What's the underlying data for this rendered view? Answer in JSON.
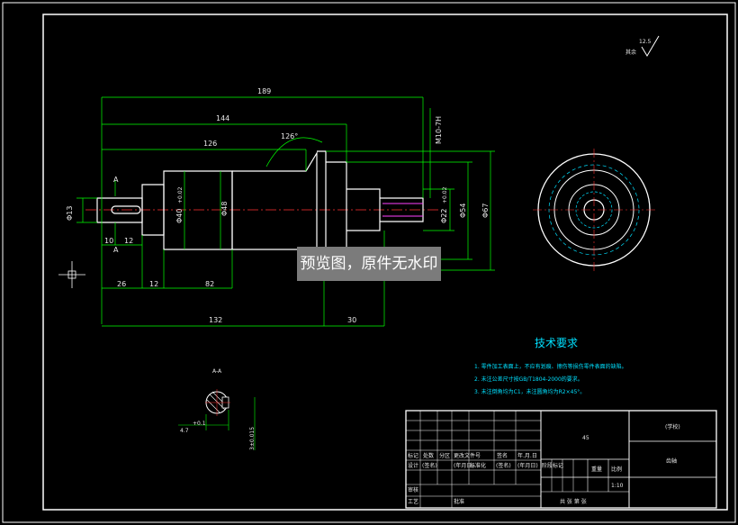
{
  "dimensions": {
    "d189": "189",
    "d144": "144",
    "d126": "126",
    "angle126": "126°",
    "d132": "132",
    "d30": "30",
    "d26": "26",
    "d12a": "12",
    "d82": "82",
    "d10": "10",
    "d12b": "12",
    "dia13": "Φ13",
    "dia40": "Φ40",
    "dia40_tol": "+0.02",
    "dia48": "Φ48",
    "dia22": "Φ22",
    "dia22_tol": "+0.02",
    "dia54": "Φ54",
    "dia67": "Φ67",
    "thread": "M10-7H",
    "sectionA": "A",
    "sectionA2": "A",
    "key_depth": "4.7",
    "key_depth_tol": "+0.1",
    "key_width": "3±0.015",
    "roughness": "12.5",
    "roughness_label": "其余"
  },
  "section_label": "A-A",
  "technical_requirements": {
    "title": "技术要求",
    "items": [
      "1. 零件加工表面上，不应有划痕、擦伤等损伤零件表面的缺陷。",
      "2. 未注公差尺寸按GB/T1804-2000的要求。",
      "3. 未注倒角均为C1，未注圆角均为R2×45°。"
    ]
  },
  "title_block": {
    "material": "45",
    "school": "(学校)",
    "part_name": "齿轴",
    "scale": "1:10",
    "weight_label": "重量",
    "scale_label": "比例",
    "sheet_label": "共 张 第 张",
    "row_labels": [
      "标记",
      "处数",
      "分区",
      "更改文件号",
      "签名",
      "年.月.日"
    ],
    "design": "设计",
    "signature": "(签名)",
    "date": "(年月日)",
    "standardize": "标准化",
    "review": "审核",
    "process": "工艺",
    "approve": "批准",
    "stage_label": "阶段标记"
  },
  "watermark": "预览图，原件无水印"
}
